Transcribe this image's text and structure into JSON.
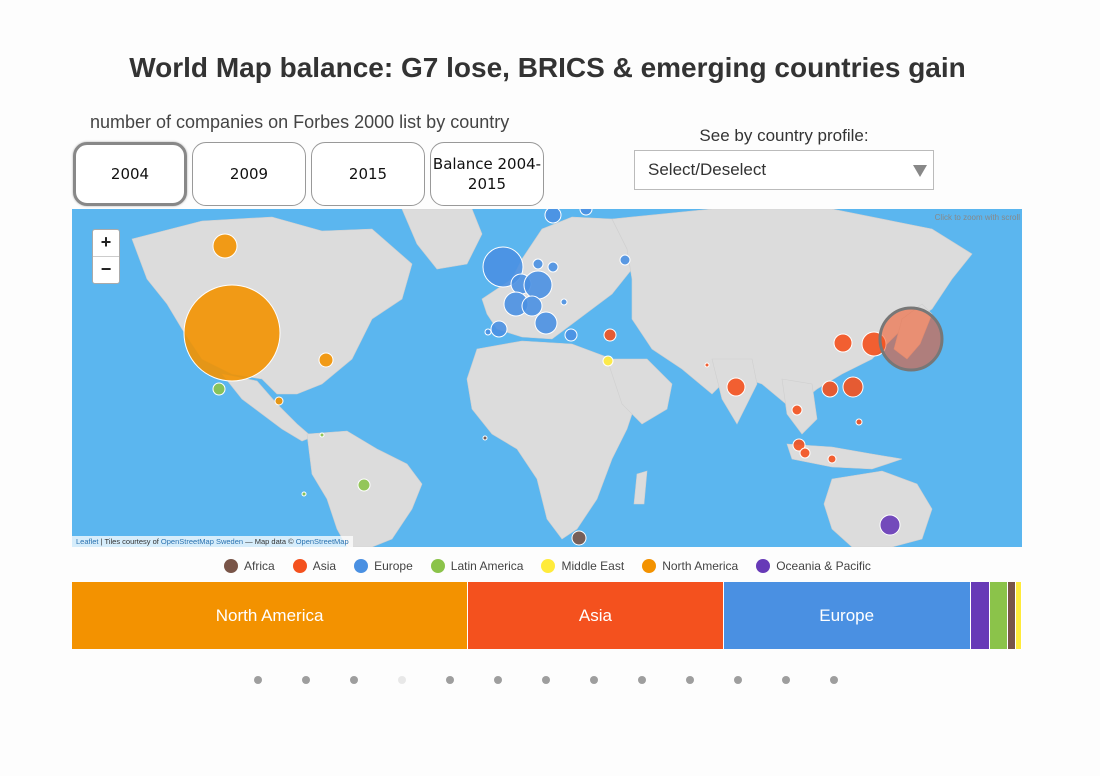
{
  "title": "World Map balance: G7 lose, BRICS & emerging countries gain",
  "subtitle": "number of companies on Forbes 2000 list by country",
  "year_buttons": [
    {
      "label": "2004",
      "active": true
    },
    {
      "label": "2009",
      "active": false
    },
    {
      "label": "2015",
      "active": false
    },
    {
      "label": "Balance 2004-2015",
      "active": false
    }
  ],
  "profile": {
    "label": "See by country profile:",
    "select_value": "Select/Deselect"
  },
  "map": {
    "zoom_in": "+",
    "zoom_out": "−",
    "zoom_hint": "Click to zoom with scroll",
    "attribution": {
      "leaflet": "Leaflet",
      "tiles_prefix": " | Tiles courtesy of ",
      "tiles_link": "OpenStreetMap Sweden",
      "data_prefix": " — Map data © ",
      "data_link": "OpenStreetMap"
    },
    "ocean_color": "#5bb6ef",
    "land_color": "#dcdcdc"
  },
  "regions": {
    "Africa": "#795548",
    "Asia": "#f4511e",
    "Europe": "#4a90e2",
    "Latin America": "#8bc34a",
    "Middle East": "#ffeb3b",
    "North America": "#f39200",
    "Oceania & Pacific": "#673ab7"
  },
  "legend": [
    {
      "label": "Africa",
      "color": "#795548"
    },
    {
      "label": "Asia",
      "color": "#f4511e"
    },
    {
      "label": "Europe",
      "color": "#4a90e2"
    },
    {
      "label": "Latin America",
      "color": "#8bc34a"
    },
    {
      "label": "Middle East",
      "color": "#ffeb3b"
    },
    {
      "label": "North America",
      "color": "#f39200"
    },
    {
      "label": "Oceania & Pacific",
      "color": "#673ab7"
    }
  ],
  "chart_data": {
    "type": "bar",
    "year": "2004",
    "stack_share": [
      {
        "label": "North America",
        "share": 41.7,
        "color": "#f39200",
        "show_label": true
      },
      {
        "label": "Asia",
        "share": 26.9,
        "color": "#f4511e",
        "show_label": true
      },
      {
        "label": "Europe",
        "share": 26.0,
        "color": "#4a90e2",
        "show_label": true
      },
      {
        "label": "Oceania & Pacific",
        "share": 2.0,
        "color": "#673ab7",
        "show_label": false
      },
      {
        "label": "Latin America",
        "share": 1.9,
        "color": "#8bc34a",
        "show_label": false
      },
      {
        "label": "Africa",
        "share": 0.9,
        "color": "#795548",
        "show_label": false
      },
      {
        "label": "Middle East",
        "share": 0.6,
        "color": "#ffeb3b",
        "show_label": false
      }
    ]
  },
  "pagination": {
    "count": 13,
    "active_index": 3
  }
}
